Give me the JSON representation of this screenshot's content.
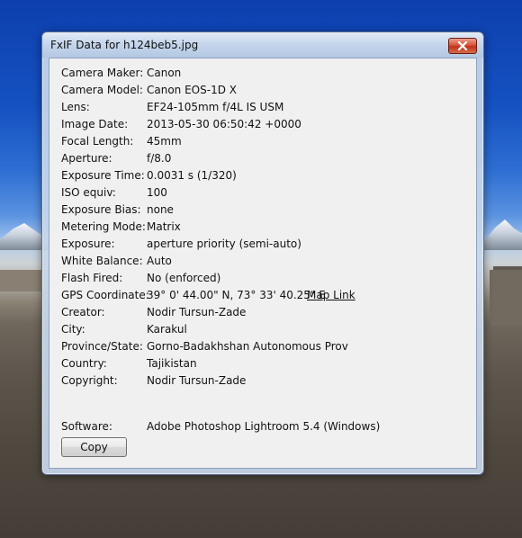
{
  "window": {
    "title": "FxIF Data for h124beb5.jpg"
  },
  "fields": [
    {
      "label": "Camera Maker:",
      "value": "Canon"
    },
    {
      "label": "Camera Model:",
      "value": "Canon EOS-1D X"
    },
    {
      "label": "Lens:",
      "value": "EF24-105mm f/4L IS USM"
    },
    {
      "label": "Image Date:",
      "value": "2013-05-30 06:50:42 +0000"
    },
    {
      "label": "Focal Length:",
      "value": "45mm"
    },
    {
      "label": "Aperture:",
      "value": "f/8.0"
    },
    {
      "label": "Exposure Time:",
      "value": "0.0031 s (1/320)"
    },
    {
      "label": "ISO equiv:",
      "value": "100"
    },
    {
      "label": "Exposure Bias:",
      "value": "none"
    },
    {
      "label": "Metering Mode:",
      "value": "Matrix"
    },
    {
      "label": "Exposure:",
      "value": "aperture priority (semi-auto)"
    },
    {
      "label": "White Balance:",
      "value": "Auto"
    },
    {
      "label": "Flash Fired:",
      "value": "No (enforced)"
    },
    {
      "label": "GPS Coordinate:",
      "value": "39° 0' 44.00\" N, 73° 33' 40.25\" E",
      "link": "Map Link"
    },
    {
      "label": "Creator:",
      "value": "Nodir Tursun-Zade"
    },
    {
      "label": "City:",
      "value": "Karakul"
    },
    {
      "label": "Province/State:",
      "value": "Gorno-Badakhshan Autonomous Prov"
    },
    {
      "label": "Country:",
      "value": "Tajikistan"
    },
    {
      "label": "Copyright:",
      "value": "Nodir Tursun-Zade"
    }
  ],
  "software": {
    "label": "Software:",
    "value": "Adobe Photoshop Lightroom 5.4 (Windows)"
  },
  "buttons": {
    "copy_label": "Copy"
  },
  "icons": {
    "close": "close-icon"
  },
  "colors": {
    "close_button": "#c2311a",
    "content_background": "#f0f0f0"
  }
}
